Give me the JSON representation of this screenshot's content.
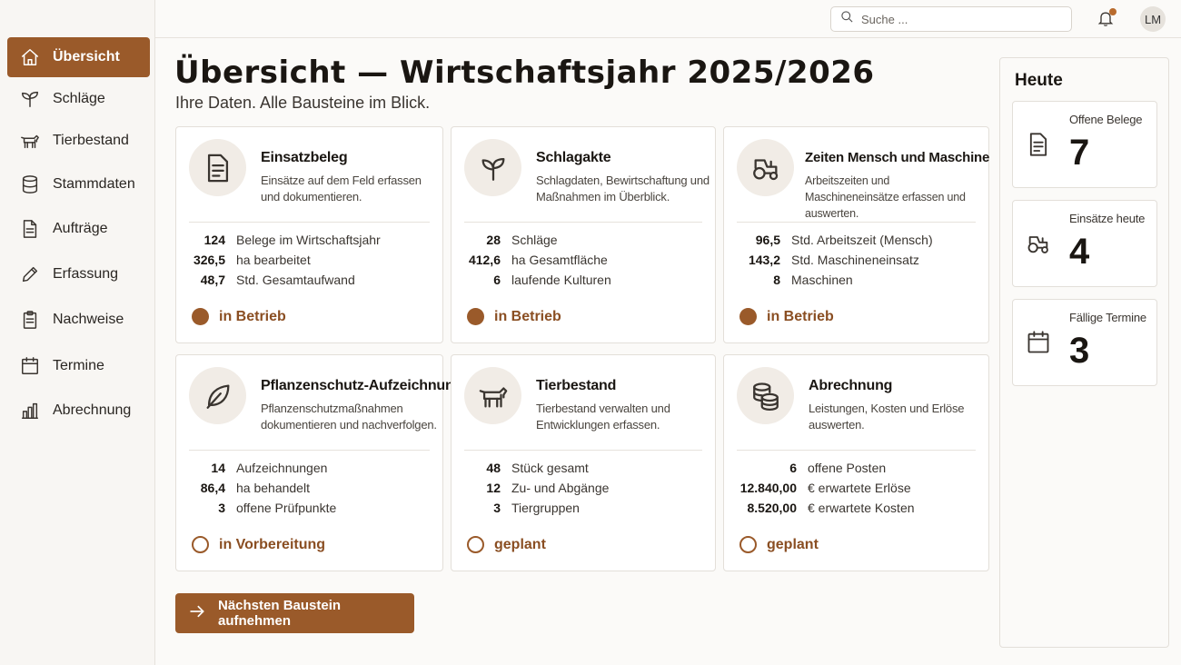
{
  "sidebar": {
    "items": [
      {
        "label": "Übersicht",
        "icon": "home-icon",
        "active": true
      },
      {
        "label": "Schläge",
        "icon": "sprout-icon"
      },
      {
        "label": "Tierbestand",
        "icon": "cow-icon"
      },
      {
        "label": "Stammdaten",
        "icon": "database-icon"
      },
      {
        "label": "Aufträge",
        "icon": "document-icon"
      },
      {
        "label": "Erfassung",
        "icon": "pencil-icon"
      },
      {
        "label": "Nachweise",
        "icon": "clipboard-icon"
      },
      {
        "label": "Termine",
        "icon": "calendar-icon"
      },
      {
        "label": "Abrechnung",
        "icon": "bar-chart-icon"
      }
    ]
  },
  "topbar": {
    "search_placeholder": "Suche ...",
    "avatar_initials": "LM"
  },
  "main": {
    "title": "Übersicht — Wirtschaftsjahr 2025/2026",
    "subtitle": "Ihre Daten. Alle Bausteine im Blick.",
    "cards": [
      {
        "title": "Einsatzbeleg",
        "description": "Einsätze auf dem Feld erfassen und dokumentieren.",
        "icon": "document-icon",
        "stats": [
          {
            "value": "124",
            "label": "Belege im Wirtschaftsjahr"
          },
          {
            "value": "326,5",
            "label": "ha bearbeitet"
          },
          {
            "value": "48,7",
            "label": "Std. Gesamtaufwand"
          }
        ],
        "status": "in Betrieb"
      },
      {
        "title": "Schlagakte",
        "description": "Schlagdaten, Bewirtschaftung und Maßnahmen im Überblick.",
        "icon": "sprout-icon",
        "stats": [
          {
            "value": "28",
            "label": "Schläge"
          },
          {
            "value": "412,6",
            "label": "ha Gesamtfläche"
          },
          {
            "value": "6",
            "label": "laufende Kulturen"
          }
        ],
        "status": "in Betrieb"
      },
      {
        "title": "Zeiten Mensch und Maschine",
        "description": "Arbeitszeiten und Maschineneinsätze erfassen und auswerten.",
        "icon": "tractor-icon",
        "stats": [
          {
            "value": "96,5",
            "label": "Std. Arbeitszeit (Mensch)"
          },
          {
            "value": "143,2",
            "label": "Std. Maschineneinsatz"
          },
          {
            "value": "8",
            "label": "Maschinen"
          }
        ],
        "status": "in Betrieb"
      },
      {
        "title": "Pflanzenschutz-Aufzeichnung",
        "description": "Pflanzenschutzmaßnahmen dokumentieren und nachverfolgen.",
        "icon": "leaf-icon",
        "stats": [
          {
            "value": "14",
            "label": "Aufzeichnungen"
          },
          {
            "value": "86,4",
            "label": "ha behandelt"
          },
          {
            "value": "3",
            "label": "offene Prüfpunkte"
          }
        ],
        "status": "in Vorbereitung"
      },
      {
        "title": "Tierbestand",
        "description": "Tierbestand verwalten und Entwicklungen erfassen.",
        "icon": "cow-icon",
        "stats": [
          {
            "value": "48",
            "label": "Stück gesamt"
          },
          {
            "value": "12",
            "label": "Zu- und Abgänge"
          },
          {
            "value": "3",
            "label": "Tiergruppen"
          }
        ],
        "status": "geplant"
      },
      {
        "title": "Abrechnung",
        "description": "Leistungen, Kosten und Erlöse auswerten.",
        "icon": "coins-icon",
        "stats": [
          {
            "value": "6",
            "label": "offene Posten"
          },
          {
            "value": "12.840,00",
            "label": "€ erwartete Erlöse"
          },
          {
            "value": "8.520,00",
            "label": "€ erwartete Kosten"
          }
        ],
        "status": "geplant"
      }
    ],
    "cta_label": "Nächsten Baustein aufnehmen"
  },
  "today": {
    "title": "Heute",
    "items": [
      {
        "label": "Offene Belege",
        "value": "7",
        "icon": "document-icon"
      },
      {
        "label": "Einsätze heute",
        "value": "4",
        "icon": "tractor-icon"
      },
      {
        "label": "Fällige Termine",
        "value": "3",
        "icon": "calendar-icon"
      }
    ]
  },
  "colors": {
    "accent": "#9a5a2a",
    "status_text": "#8a4e22",
    "background": "#fbfaf8"
  }
}
